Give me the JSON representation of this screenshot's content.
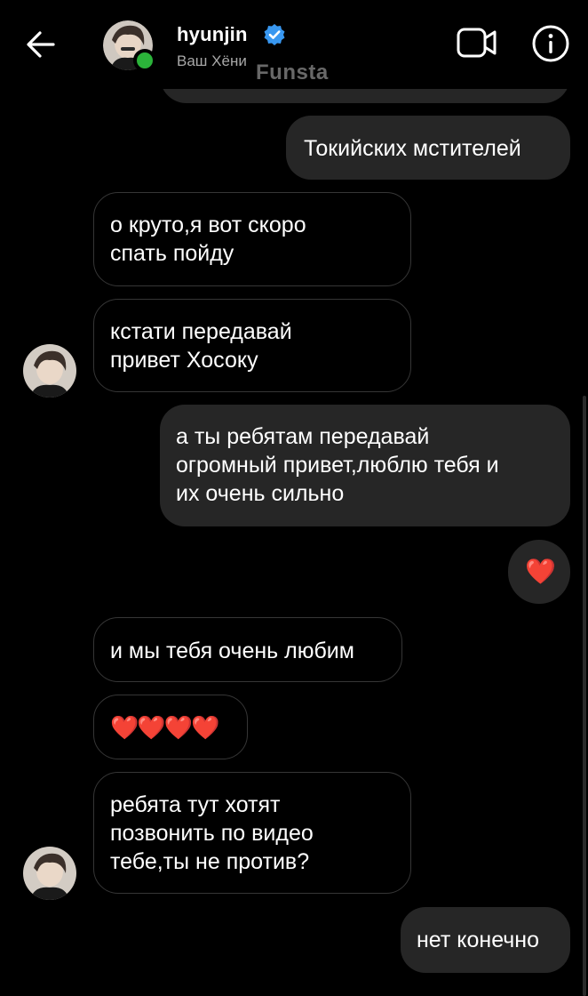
{
  "header": {
    "username": "hyunjin",
    "subtitle": "Ваш Хёни",
    "watermark": "Funsta",
    "icons": {
      "back": "arrow-left-icon",
      "verified": "verified-badge-icon",
      "video": "video-call-icon",
      "info": "info-icon"
    },
    "online_color": "#2bb33a",
    "verified_color": "#3897f0"
  },
  "messages": [
    {
      "from": "me",
      "text": "Токийских мстителей"
    },
    {
      "from": "them",
      "text": "о круто,я вот скоро\nспать пойду"
    },
    {
      "from": "them",
      "text": "кстати передавай\nпривет Хосоку"
    },
    {
      "from": "me",
      "text": "а ты ребятам передавай\nогромный привет,люблю тебя и\nих очень сильно"
    },
    {
      "from": "me",
      "text": "❤️"
    },
    {
      "from": "them",
      "text": "и мы тебя очень любим"
    },
    {
      "from": "them",
      "text": "❤️❤️❤️❤️"
    },
    {
      "from": "them",
      "text": "ребята тут хотят\nпозвонить по видео\nтебе,ты не против?"
    },
    {
      "from": "me",
      "text": "нет конечно"
    }
  ],
  "colors": {
    "background": "#000000",
    "outgoing_bubble": "#262626",
    "incoming_border": "#363636",
    "heart": "#e0263c"
  }
}
